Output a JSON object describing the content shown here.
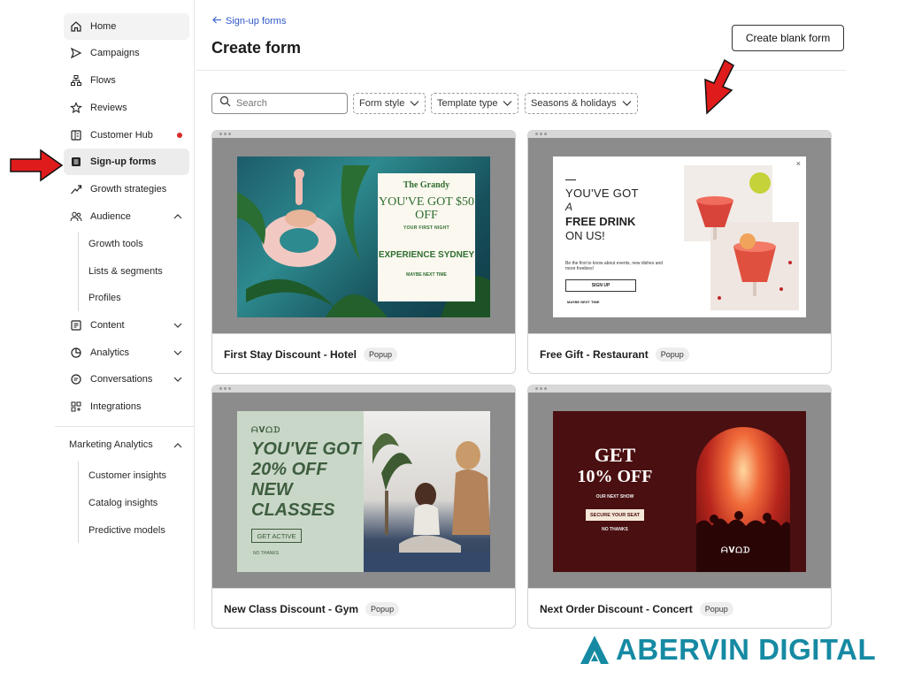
{
  "sidebar": {
    "items": [
      {
        "label": "Home",
        "icon": "home-icon"
      },
      {
        "label": "Campaigns",
        "icon": "send-icon"
      },
      {
        "label": "Flows",
        "icon": "flows-icon"
      },
      {
        "label": "Reviews",
        "icon": "star-icon"
      },
      {
        "label": "Customer Hub",
        "icon": "hub-icon"
      },
      {
        "label": "Sign-up forms",
        "icon": "form-icon"
      },
      {
        "label": "Growth strategies",
        "icon": "trend-icon"
      },
      {
        "label": "Audience",
        "icon": "people-icon"
      },
      {
        "label": "Content",
        "icon": "content-icon"
      },
      {
        "label": "Analytics",
        "icon": "analytics-icon"
      },
      {
        "label": "Conversations",
        "icon": "chat-icon"
      },
      {
        "label": "Integrations",
        "icon": "integrations-icon"
      }
    ],
    "audience_sub": [
      "Growth tools",
      "Lists & segments",
      "Profiles"
    ],
    "marketing_analytics": {
      "title": "Marketing Analytics",
      "items": [
        "Customer insights",
        "Catalog insights",
        "Predictive models"
      ]
    }
  },
  "header": {
    "back_label": "Sign-up forms",
    "title": "Create form",
    "create_button": "Create blank form"
  },
  "filters": {
    "search_placeholder": "Search",
    "dropdowns": [
      "Form style",
      "Template type",
      "Seasons & holidays"
    ]
  },
  "templates": [
    {
      "name": "First Stay Discount - Hotel",
      "badge": "Popup",
      "preview": {
        "brand": "The Grandy",
        "headline": "YOU'VE GOT $50 OFF",
        "subline": "YOUR FIRST NIGHT",
        "cta": "EXPERIENCE SYDNEY",
        "dismiss": "MAYBE NEXT TIME"
      }
    },
    {
      "name": "Free Gift - Restaurant",
      "badge": "Popup",
      "preview": {
        "line1": "YOU'VE GOT",
        "line2": "A",
        "line3": "FREE DRINK",
        "line4": "ON US!",
        "body": "Be the first to know about events, new dishes and more freebies!",
        "cta": "SIGN UP",
        "dismiss": "MAYBE NEXT TIME",
        "close": "×"
      }
    },
    {
      "name": "New Class Discount - Gym",
      "badge": "Popup",
      "preview": {
        "logo": "ᗩᐯᗝᗪ",
        "headline": "YOU'VE GOT 20% OFF NEW CLASSES",
        "cta": "GET ACTIVE",
        "dismiss": "NO THANKS"
      }
    },
    {
      "name": "Next Order Discount - Concert",
      "badge": "Popup",
      "preview": {
        "line1": "GET",
        "line2": "10% OFF",
        "subline": "OUR NEXT SHOW",
        "cta": "SECURE YOUR SEAT",
        "dismiss": "NO THANKS",
        "logo": "ᗩᐯᗝᗪ"
      }
    }
  ],
  "brand": {
    "name": "ABERVIN DIGITAL",
    "color": "#168aa3"
  },
  "colors": {
    "accent_link": "#2f58c9",
    "annotation_arrow": "#e01b1b",
    "status_dot": "#d62b2b"
  }
}
